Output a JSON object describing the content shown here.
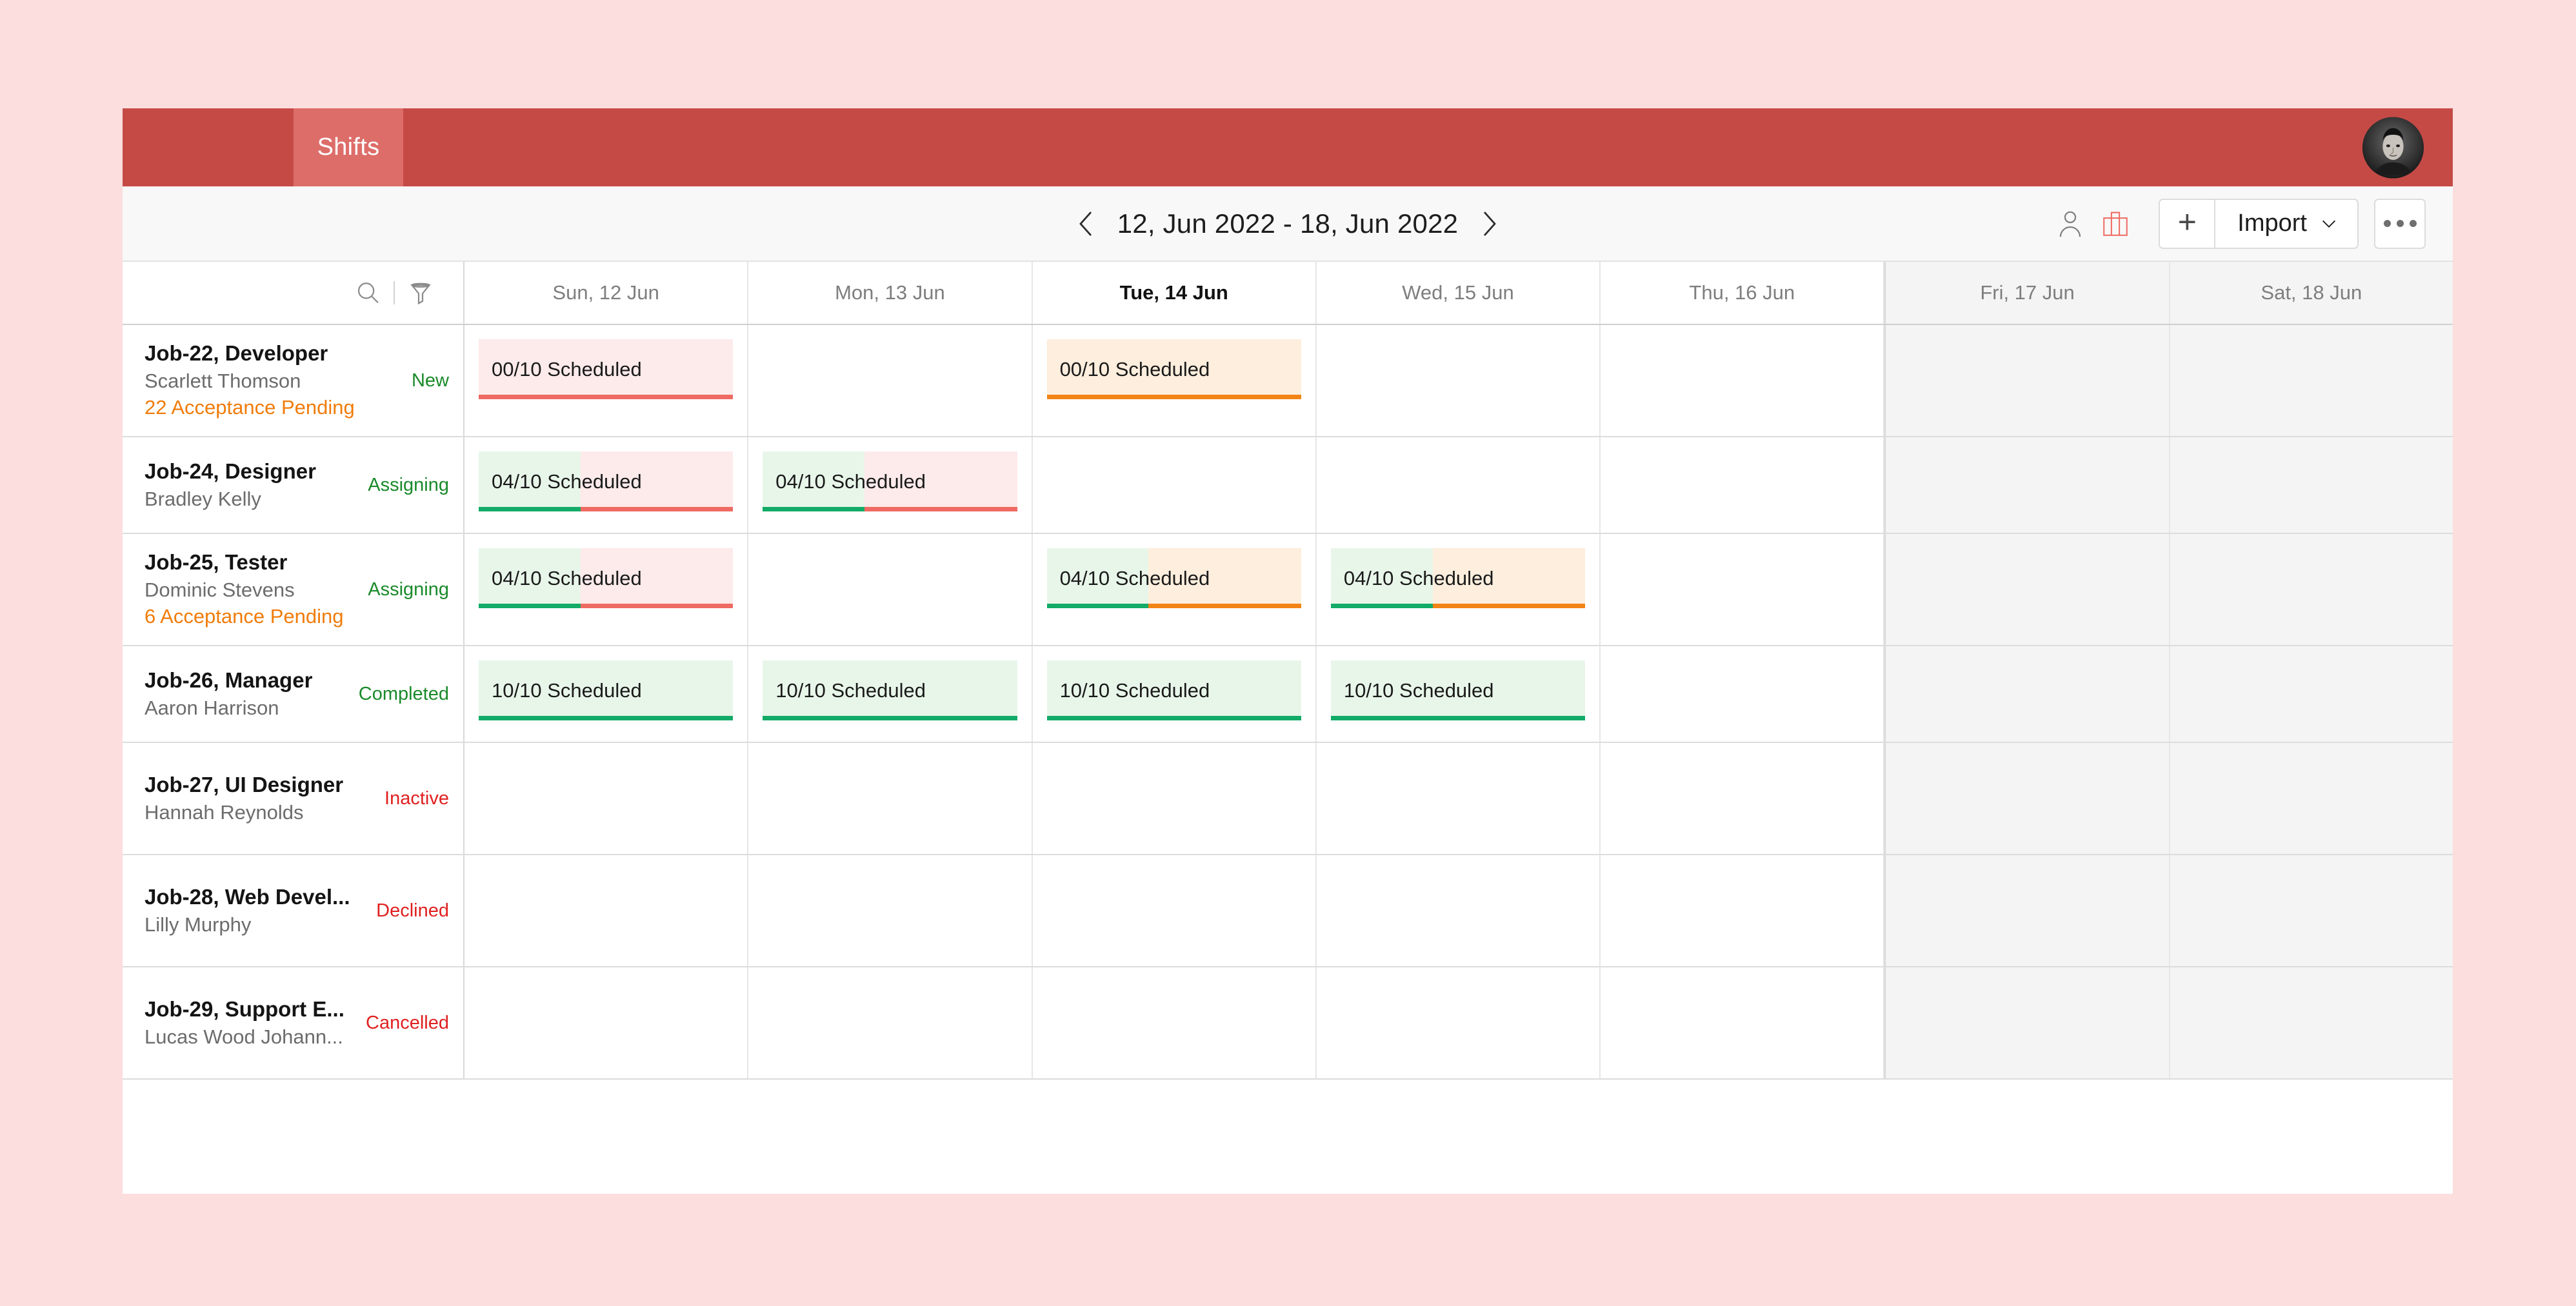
{
  "app": {
    "brand_color": "#c54a46",
    "tab_active_color": "#dd6d69"
  },
  "topbar": {
    "tab_label": "Shifts",
    "avatar_name": "user-avatar"
  },
  "toolbar": {
    "prev_icon": "chevron-left-icon",
    "next_icon": "chevron-right-icon",
    "date_range": "12, Jun 2022 - 18, Jun 2022",
    "person_icon": "person-icon",
    "briefcase_icon": "briefcase-icon",
    "briefcase_color": "#ef6a62",
    "add_label": "+",
    "import_label": "Import",
    "import_caret_icon": "chevron-down-icon",
    "more_icon": "more-horizontal-icon"
  },
  "grid": {
    "search_icon": "search-icon",
    "filter_icon": "filter-icon",
    "days": [
      {
        "label": "Sun, 12 Jun",
        "today": false,
        "weekend": false
      },
      {
        "label": "Mon, 13 Jun",
        "today": false,
        "weekend": false
      },
      {
        "label": "Tue, 14 Jun",
        "today": true,
        "weekend": false
      },
      {
        "label": "Wed, 15 Jun",
        "today": false,
        "weekend": false
      },
      {
        "label": "Thu, 16 Jun",
        "today": false,
        "weekend": false
      },
      {
        "label": "Fri, 17 Jun",
        "today": false,
        "weekend": true
      },
      {
        "label": "Sat, 18 Jun",
        "today": false,
        "weekend": true
      }
    ],
    "status_colors": {
      "New": "#1a8a2a",
      "Assigning": "#1a8a2a",
      "Completed": "#1a8a2a",
      "Inactive": "#e02020",
      "Declined": "#e02020",
      "Cancelled": "#e02020"
    },
    "rows": [
      {
        "title": "Job-22, Developer",
        "person": "Scarlett Thomson",
        "pending": "22 Acceptance Pending",
        "status": "New",
        "cells": [
          {
            "label": "00/10 Scheduled",
            "filled_pct": 0,
            "remainder": "red"
          },
          null,
          {
            "label": "00/10 Scheduled",
            "filled_pct": 0,
            "remainder": "orange"
          },
          null,
          null,
          null,
          null
        ]
      },
      {
        "title": "Job-24, Designer",
        "person": "Bradley Kelly",
        "pending": "",
        "status": "Assigning",
        "cells": [
          {
            "label": "04/10 Scheduled",
            "filled_pct": 40,
            "remainder": "red"
          },
          {
            "label": "04/10 Scheduled",
            "filled_pct": 40,
            "remainder": "red"
          },
          null,
          null,
          null,
          null,
          null
        ]
      },
      {
        "title": "Job-25, Tester",
        "person": "Dominic Stevens",
        "pending": "6 Acceptance Pending",
        "status": "Assigning",
        "cells": [
          {
            "label": "04/10 Scheduled",
            "filled_pct": 40,
            "remainder": "red"
          },
          null,
          {
            "label": "04/10 Scheduled",
            "filled_pct": 40,
            "remainder": "orange"
          },
          {
            "label": "04/10 Scheduled",
            "filled_pct": 40,
            "remainder": "orange"
          },
          null,
          null,
          null
        ]
      },
      {
        "title": "Job-26, Manager",
        "person": "Aaron Harrison",
        "pending": "",
        "status": "Completed",
        "cells": [
          {
            "label": "10/10 Scheduled",
            "filled_pct": 100,
            "remainder": "none"
          },
          {
            "label": "10/10 Scheduled",
            "filled_pct": 100,
            "remainder": "none"
          },
          {
            "label": "10/10 Scheduled",
            "filled_pct": 100,
            "remainder": "none"
          },
          {
            "label": "10/10 Scheduled",
            "filled_pct": 100,
            "remainder": "none"
          },
          null,
          null,
          null
        ]
      },
      {
        "title": "Job-27, UI Designer",
        "person": "Hannah Reynolds",
        "pending": "",
        "status": "Inactive",
        "cells": [
          null,
          null,
          null,
          null,
          null,
          null,
          null
        ]
      },
      {
        "title": "Job-28, Web Devel...",
        "person": "Lilly Murphy",
        "pending": "",
        "status": "Declined",
        "cells": [
          null,
          null,
          null,
          null,
          null,
          null,
          null
        ]
      },
      {
        "title": "Job-29, Support E...",
        "person": "Lucas Wood Johann...",
        "pending": "",
        "status": "Cancelled",
        "cells": [
          null,
          null,
          null,
          null,
          null,
          null,
          null
        ]
      }
    ]
  }
}
